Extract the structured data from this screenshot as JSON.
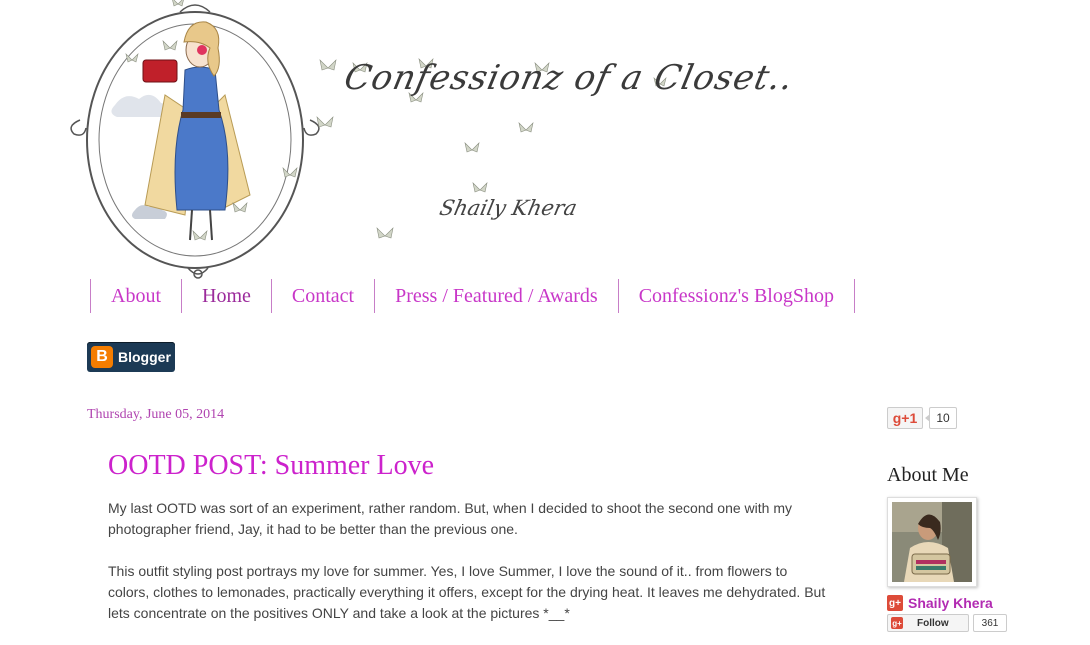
{
  "header": {
    "blog_title": "Confessionz of a Closet..",
    "author_signature": "Shaily Khera"
  },
  "nav": {
    "items": [
      {
        "label": "About"
      },
      {
        "label": "Home"
      },
      {
        "label": "Contact"
      },
      {
        "label": "Press / Featured / Awards"
      },
      {
        "label": "Confessionz's BlogShop"
      }
    ],
    "active_index": 1
  },
  "badge": {
    "icon": "blogger-icon",
    "letter": "B",
    "label": "Blogger"
  },
  "post": {
    "date": "Thursday, June 05, 2014",
    "title": "OOTD POST: Summer Love",
    "paragraphs": [
      "My last OOTD was sort of an experiment, rather random. But, when I decided to shoot the second one with my photographer friend, Jay, it had to be better than the previous one.",
      "This outfit styling post portrays my love for summer. Yes, I love Summer, I love the sound of it.. from flowers to colors, clothes to lemonades, practically everything it offers, except for the drying heat. It leaves me dehydrated. But lets concentrate on the positives ONLY and take a look at the pictures *__*"
    ]
  },
  "sidebar": {
    "gplus_label": "g+1",
    "gplus_count": "10",
    "about_heading": "About Me",
    "profile_name": "Shaily Khera",
    "gp_badge": "g+",
    "follow_label": "Follow",
    "follow_count": "361"
  },
  "colors": {
    "accent": "#cc22cc",
    "nav_text": "#c837c8",
    "badge_bg": "#1c3a55",
    "blogger_orange": "#f57d00",
    "gplus_red": "#dd4b39"
  }
}
